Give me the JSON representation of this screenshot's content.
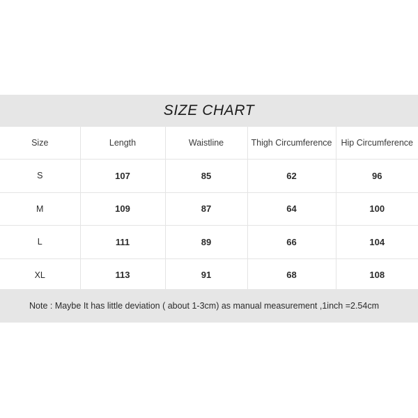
{
  "title": "SIZE CHART",
  "table": {
    "headers": [
      "Size",
      "Length",
      "Waistline",
      "Thigh Circumference",
      "Hip Circumference"
    ],
    "rows": [
      {
        "size": "S",
        "length": "107",
        "waistline": "85",
        "thigh": "62",
        "hip": "96"
      },
      {
        "size": "M",
        "length": "109",
        "waistline": "87",
        "thigh": "64",
        "hip": "100"
      },
      {
        "size": "L",
        "length": "111",
        "waistline": "89",
        "thigh": "66",
        "hip": "104"
      },
      {
        "size": "XL",
        "length": "113",
        "waistline": "91",
        "thigh": "68",
        "hip": "108"
      }
    ]
  },
  "note": "Note : Maybe It has little deviation ( about 1-3cm) as manual measurement ,1inch =2.54cm",
  "colors": {
    "band_background": "#e6e6e6",
    "page_background": "#ffffff",
    "grid_line": "#e4e4e4",
    "text": "#2b2b2b"
  }
}
